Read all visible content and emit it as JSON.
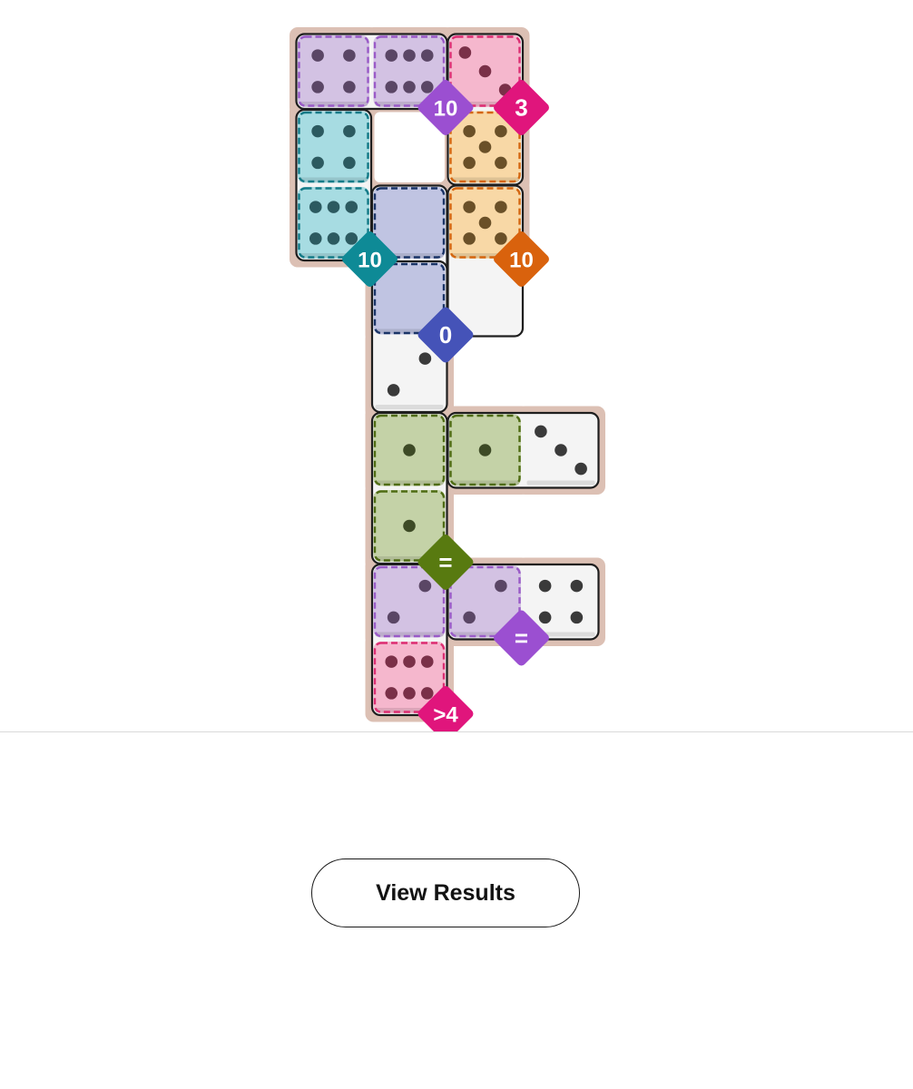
{
  "board": {
    "rows": 9,
    "cols": 4,
    "region_colors": {
      "purple": {
        "fill": "#d3c2e3",
        "border": "#9a5bc7",
        "badge": "#9b4fd1"
      },
      "pink": {
        "fill": "#f5b7cd",
        "border": "#dc2f73",
        "badge": "#e0157c"
      },
      "teal": {
        "fill": "#a7dce2",
        "border": "#157b88",
        "badge": "#0e8a96"
      },
      "orange": {
        "fill": "#f8d8a6",
        "border": "#d46611",
        "badge": "#d9620d"
      },
      "navy": {
        "fill": "#c0c4e2",
        "border": "#1a3467",
        "badge": "#4553b8"
      },
      "green": {
        "fill": "#c4d2a7",
        "border": "#4f6c14",
        "badge": "#587a10"
      }
    },
    "cells": [
      {
        "row": 0,
        "col": 0,
        "pips": 4,
        "region": "purple"
      },
      {
        "row": 0,
        "col": 1,
        "pips": 6,
        "region": "purple"
      },
      {
        "row": 0,
        "col": 2,
        "pips": 3,
        "region": "pink"
      },
      {
        "row": 1,
        "col": 0,
        "pips": 4,
        "region": "teal"
      },
      {
        "row": 1,
        "col": 2,
        "pips": 5,
        "region": "orange"
      },
      {
        "row": 2,
        "col": 0,
        "pips": 6,
        "region": "teal"
      },
      {
        "row": 2,
        "col": 1,
        "pips": 0,
        "region": "navy"
      },
      {
        "row": 2,
        "col": 2,
        "pips": 5,
        "region": "orange"
      },
      {
        "row": 3,
        "col": 1,
        "pips": 0,
        "region": "navy"
      },
      {
        "row": 4,
        "col": 1,
        "pips": 2,
        "region": null
      },
      {
        "row": 5,
        "col": 1,
        "pips": 1,
        "region": "green"
      },
      {
        "row": 5,
        "col": 2,
        "pips": 1,
        "region": "green"
      },
      {
        "row": 5,
        "col": 3,
        "pips": 3,
        "region": null
      },
      {
        "row": 6,
        "col": 1,
        "pips": 1,
        "region": "green"
      },
      {
        "row": 7,
        "col": 1,
        "pips": 2,
        "region": "purple"
      },
      {
        "row": 7,
        "col": 2,
        "pips": 2,
        "region": "purple"
      },
      {
        "row": 7,
        "col": 3,
        "pips": 4,
        "region": null
      },
      {
        "row": 8,
        "col": 1,
        "pips": 6,
        "region": "pink"
      }
    ],
    "empty_slots": [
      {
        "row": 1,
        "col": 1
      }
    ],
    "dominoes": [
      {
        "cells": [
          [
            0,
            0
          ],
          [
            0,
            1
          ]
        ]
      },
      {
        "cells": [
          [
            0,
            2
          ],
          [
            1,
            2
          ]
        ]
      },
      {
        "cells": [
          [
            1,
            0
          ],
          [
            2,
            0
          ]
        ]
      },
      {
        "cells": [
          [
            2,
            1
          ],
          [
            3,
            1
          ]
        ]
      },
      {
        "cells": [
          [
            2,
            2
          ],
          [
            3,
            2
          ]
        ]
      },
      {
        "cells": [
          [
            4,
            1
          ],
          [
            3,
            1
          ]
        ]
      },
      {
        "cells": [
          [
            5,
            1
          ],
          [
            6,
            1
          ]
        ]
      },
      {
        "cells": [
          [
            5,
            2
          ],
          [
            5,
            3
          ]
        ]
      },
      {
        "cells": [
          [
            7,
            1
          ],
          [
            8,
            1
          ]
        ]
      },
      {
        "cells": [
          [
            7,
            2
          ],
          [
            7,
            3
          ]
        ]
      }
    ],
    "constraints": [
      {
        "label": "10",
        "color": "purple",
        "row": 0,
        "col": 1
      },
      {
        "label": "3",
        "color": "pink",
        "row": 0,
        "col": 2
      },
      {
        "label": "10",
        "color": "teal",
        "row": 2,
        "col": 0
      },
      {
        "label": "10",
        "color": "orange",
        "row": 2,
        "col": 2
      },
      {
        "label": "0",
        "color": "navy",
        "row": 3,
        "col": 1
      },
      {
        "label": "=",
        "color": "green",
        "row": 6,
        "col": 1
      },
      {
        "label": "=",
        "color": "purple",
        "row": 7,
        "col": 2
      },
      {
        "label": ">4",
        "color": "pink",
        "row": 8,
        "col": 1
      }
    ]
  },
  "view_results_label": "View Results"
}
